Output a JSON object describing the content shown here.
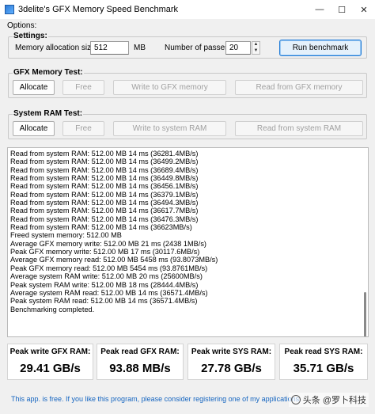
{
  "window": {
    "title": "3delite's GFX Memory Speed Benchmark",
    "minimize": "—",
    "maximize": "☐",
    "close": "✕"
  },
  "options_label": "Options:",
  "settings": {
    "title": "Settings:",
    "mem_alloc_label": "Memory allocation size:",
    "mem_alloc_value": "512",
    "mem_alloc_unit": "MB",
    "passes_label": "Number of passes:",
    "passes_value": "20",
    "spin_up": "▲",
    "spin_down": "▼",
    "run_label": "Run benchmark"
  },
  "gfx_test": {
    "title": "GFX Memory Test:",
    "allocate": "Allocate",
    "free": "Free",
    "write": "Write to GFX memory",
    "read": "Read from GFX memory"
  },
  "ram_test": {
    "title": "System RAM Test:",
    "allocate": "Allocate",
    "free": "Free",
    "write": "Write to system RAM",
    "read": "Read from system RAM"
  },
  "log": [
    "Read from system RAM: 512.00 MB 14 ms (36281.4MB/s)",
    "Read from system RAM: 512.00 MB 14 ms (36499.2MB/s)",
    "Read from system RAM: 512.00 MB 14 ms (36689.4MB/s)",
    "Read from system RAM: 512.00 MB 14 ms (36449.8MB/s)",
    "Read from system RAM: 512.00 MB 14 ms (36456.1MB/s)",
    "Read from system RAM: 512.00 MB 14 ms (36379.1MB/s)",
    "Read from system RAM: 512.00 MB 14 ms (36494.3MB/s)",
    "Read from system RAM: 512.00 MB 14 ms (36617.7MB/s)",
    "Read from system RAM: 512.00 MB 14 ms (36476.3MB/s)",
    "Read from system RAM: 512.00 MB 14 ms (36623MB/s)",
    "Freed system memory: 512.00 MB",
    "Average GFX memory write: 512.00 MB 21 ms (2438 1MB/s)",
    "Peak GFX memory write: 512.00 MB 17 ms (30117.6MB/s)",
    "Average GFX memory read: 512.00 MB 5458 ms (93.8073MB/s)",
    "Peak GFX memory read: 512.00 MB 5454 ms (93.8761MB/s)",
    "Average system RAM write: 512.00 MB 20 ms (25600MB/s)",
    "Peak system RAM write: 512.00 MB 18 ms (28444.4MB/s)",
    "Average system RAM read: 512.00 MB 14 ms (36571.4MB/s)",
    "Peak system RAM read: 512.00 MB 14 ms (36571.4MB/s)",
    "Benchmarking completed."
  ],
  "stats": [
    {
      "label": "Peak write GFX RAM:",
      "value": "29.41 GB/s"
    },
    {
      "label": "Peak read GFX RAM:",
      "value": "93.88 MB/s"
    },
    {
      "label": "Peak write SYS RAM:",
      "value": "27.78 GB/s"
    },
    {
      "label": "Peak read SYS RAM:",
      "value": "35.71 GB/s"
    }
  ],
  "footer_text": "This app. is free. If you like this program, please consider registering one of my applications.",
  "watermark": "头条 @罗卜科技"
}
